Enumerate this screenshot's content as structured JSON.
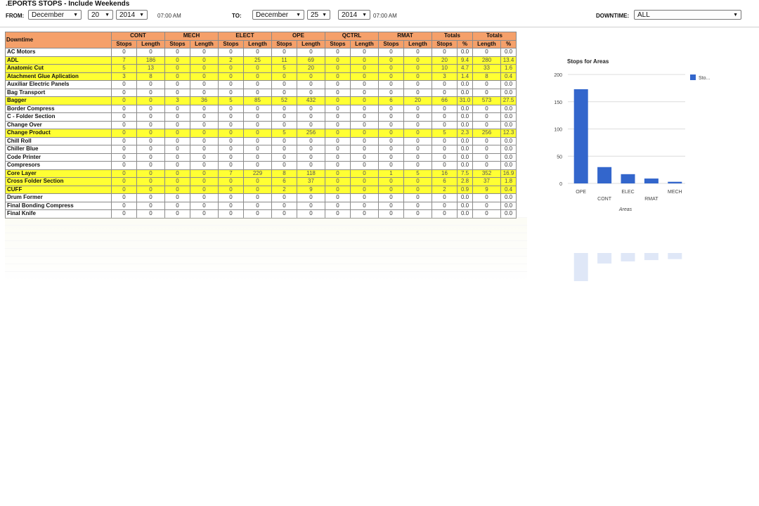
{
  "page": {
    "title": ".EPORTS STOPS - Include Weekends"
  },
  "filters": {
    "from_label": "FROM:",
    "from_month": "December",
    "from_day": "20",
    "from_year": "2014",
    "from_time": "07:00 AM",
    "to_label": "TO:",
    "to_month": "December",
    "to_day": "25",
    "to_year": "2014",
    "to_time": "07:00 AM",
    "downtime_label": "DOWNTIME:",
    "downtime_value": "ALL"
  },
  "table": {
    "row_header": "Downtime",
    "groups": [
      "CONT",
      "MECH",
      "ELECT",
      "OPE",
      "QCTRL",
      "RMAT",
      "Totals",
      "Totals"
    ],
    "subheaders": [
      "Stops",
      "Length",
      "Stops",
      "Length",
      "Stops",
      "Length",
      "Stops",
      "Length",
      "Stops",
      "Length",
      "Stops",
      "Length",
      "Stops",
      "%",
      "Length",
      "%"
    ],
    "rows": [
      {
        "name": "AC Motors",
        "hl": false,
        "cells": [
          "0",
          "0",
          "0",
          "0",
          "0",
          "0",
          "0",
          "0",
          "0",
          "0",
          "0",
          "0",
          "0",
          "0.0",
          "0",
          "0.0"
        ]
      },
      {
        "name": "ADL",
        "hl": true,
        "cells": [
          "7",
          "186",
          "0",
          "0",
          "2",
          "25",
          "11",
          "69",
          "0",
          "0",
          "0",
          "0",
          "20",
          "9.4",
          "280",
          "13.4"
        ]
      },
      {
        "name": "Anatomic Cut",
        "hl": true,
        "cells": [
          "5",
          "13",
          "0",
          "0",
          "0",
          "0",
          "5",
          "20",
          "0",
          "0",
          "0",
          "0",
          "10",
          "4.7",
          "33",
          "1.6"
        ]
      },
      {
        "name": "Atachment Glue Aplication",
        "hl": true,
        "cells": [
          "3",
          "8",
          "0",
          "0",
          "0",
          "0",
          "0",
          "0",
          "0",
          "0",
          "0",
          "0",
          "3",
          "1.4",
          "8",
          "0.4"
        ]
      },
      {
        "name": "Auxiliar Electric Panels",
        "hl": false,
        "cells": [
          "0",
          "0",
          "0",
          "0",
          "0",
          "0",
          "0",
          "0",
          "0",
          "0",
          "0",
          "0",
          "0",
          "0.0",
          "0",
          "0.0"
        ]
      },
      {
        "name": "Bag Transport",
        "hl": false,
        "cells": [
          "0",
          "0",
          "0",
          "0",
          "0",
          "0",
          "0",
          "0",
          "0",
          "0",
          "0",
          "0",
          "0",
          "0.0",
          "0",
          "0.0"
        ]
      },
      {
        "name": "Bagger",
        "hl": true,
        "cells": [
          "0",
          "0",
          "3",
          "36",
          "5",
          "85",
          "52",
          "432",
          "0",
          "0",
          "6",
          "20",
          "66",
          "31.0",
          "573",
          "27.5"
        ]
      },
      {
        "name": "Border Compress",
        "hl": false,
        "cells": [
          "0",
          "0",
          "0",
          "0",
          "0",
          "0",
          "0",
          "0",
          "0",
          "0",
          "0",
          "0",
          "0",
          "0.0",
          "0",
          "0.0"
        ]
      },
      {
        "name": "C - Folder Section",
        "hl": false,
        "cells": [
          "0",
          "0",
          "0",
          "0",
          "0",
          "0",
          "0",
          "0",
          "0",
          "0",
          "0",
          "0",
          "0",
          "0.0",
          "0",
          "0.0"
        ]
      },
      {
        "name": "Change Over",
        "hl": false,
        "cells": [
          "0",
          "0",
          "0",
          "0",
          "0",
          "0",
          "0",
          "0",
          "0",
          "0",
          "0",
          "0",
          "0",
          "0.0",
          "0",
          "0.0"
        ]
      },
      {
        "name": "Change Product",
        "hl": true,
        "cells": [
          "0",
          "0",
          "0",
          "0",
          "0",
          "0",
          "5",
          "256",
          "0",
          "0",
          "0",
          "0",
          "5",
          "2.3",
          "256",
          "12.3"
        ]
      },
      {
        "name": "Chill Roll",
        "hl": false,
        "cells": [
          "0",
          "0",
          "0",
          "0",
          "0",
          "0",
          "0",
          "0",
          "0",
          "0",
          "0",
          "0",
          "0",
          "0.0",
          "0",
          "0.0"
        ]
      },
      {
        "name": "Chiller Blue",
        "hl": false,
        "cells": [
          "0",
          "0",
          "0",
          "0",
          "0",
          "0",
          "0",
          "0",
          "0",
          "0",
          "0",
          "0",
          "0",
          "0.0",
          "0",
          "0.0"
        ]
      },
      {
        "name": "Code Printer",
        "hl": false,
        "cells": [
          "0",
          "0",
          "0",
          "0",
          "0",
          "0",
          "0",
          "0",
          "0",
          "0",
          "0",
          "0",
          "0",
          "0.0",
          "0",
          "0.0"
        ]
      },
      {
        "name": "Compresors",
        "hl": false,
        "cells": [
          "0",
          "0",
          "0",
          "0",
          "0",
          "0",
          "0",
          "0",
          "0",
          "0",
          "0",
          "0",
          "0",
          "0.0",
          "0",
          "0.0"
        ]
      },
      {
        "name": "Core Layer",
        "hl": true,
        "cells": [
          "0",
          "0",
          "0",
          "0",
          "7",
          "229",
          "8",
          "118",
          "0",
          "0",
          "1",
          "5",
          "16",
          "7.5",
          "352",
          "16.9"
        ]
      },
      {
        "name": "Cross Folder Section",
        "hl": true,
        "cells": [
          "0",
          "0",
          "0",
          "0",
          "0",
          "0",
          "6",
          "37",
          "0",
          "0",
          "0",
          "0",
          "6",
          "2.8",
          "37",
          "1.8"
        ]
      },
      {
        "name": "CUFF",
        "hl": true,
        "cells": [
          "0",
          "0",
          "0",
          "0",
          "0",
          "0",
          "2",
          "9",
          "0",
          "0",
          "0",
          "0",
          "2",
          "0.9",
          "9",
          "0.4"
        ]
      },
      {
        "name": "Drum Former",
        "hl": false,
        "cells": [
          "0",
          "0",
          "0",
          "0",
          "0",
          "0",
          "0",
          "0",
          "0",
          "0",
          "0",
          "0",
          "0",
          "0.0",
          "0",
          "0.0"
        ]
      },
      {
        "name": "Final Bonding Compress",
        "hl": false,
        "cells": [
          "0",
          "0",
          "0",
          "0",
          "0",
          "0",
          "0",
          "0",
          "0",
          "0",
          "0",
          "0",
          "0",
          "0.0",
          "0",
          "0.0"
        ]
      },
      {
        "name": "Final Knife",
        "hl": false,
        "cells": [
          "0",
          "0",
          "0",
          "0",
          "0",
          "0",
          "0",
          "0",
          "0",
          "0",
          "0",
          "0",
          "0",
          "0.0",
          "0",
          "0.0"
        ]
      }
    ]
  },
  "colors": {
    "header_bg": "#f5a06a",
    "highlight_row": "#ffff33",
    "bar": "#3366cc"
  },
  "chart_data": {
    "type": "bar",
    "title": "Stops for Areas",
    "xlabel": "Areas",
    "ylabel": "",
    "categories": [
      "OPE",
      "CONT",
      "ELEC",
      "RMAT",
      "MECH"
    ],
    "series": [
      {
        "name": "Sto...",
        "values": [
          173,
          30,
          17,
          9,
          3
        ]
      }
    ],
    "yticks": [
      "0",
      "50",
      "100",
      "150",
      "200"
    ],
    "ylim": [
      0,
      200
    ],
    "grid": true,
    "legend": "right"
  }
}
